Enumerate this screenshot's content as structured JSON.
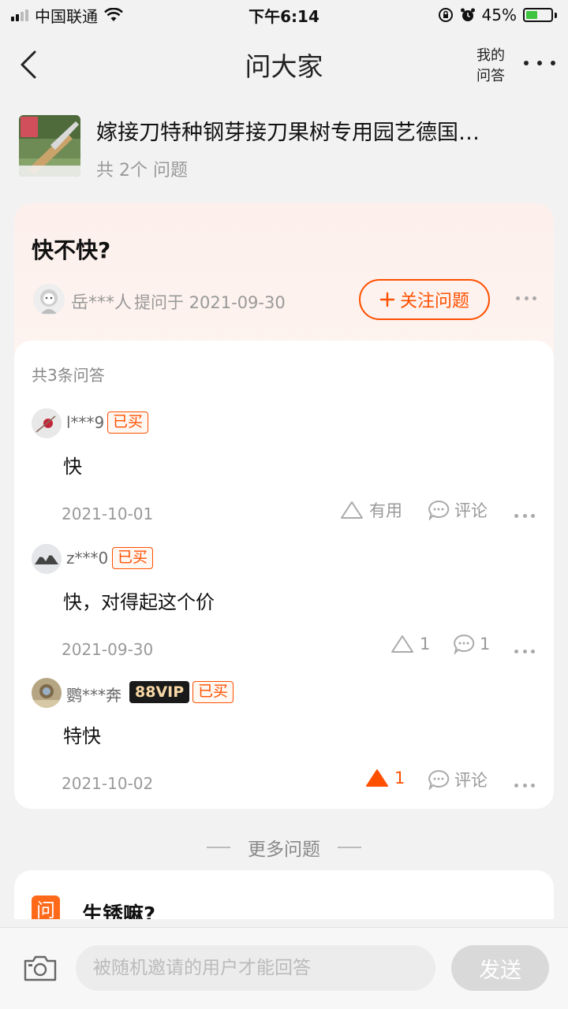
{
  "status_bar": {
    "carrier": "中国联通",
    "time": "下午6:14",
    "battery": "45%",
    "battery_level": 0.45
  },
  "nav": {
    "title": "问大家",
    "my_qa": "我的问答"
  },
  "product": {
    "name": "嫁接刀特种钢芽接刀果树专用园艺德国…",
    "question_count": "共 2个 问题"
  },
  "question": {
    "title": "快不快?",
    "asker": "岳***人",
    "asked_meta": "提问于 2021-09-30",
    "follow_label": "关注问题"
  },
  "answers_header": "共3条问答",
  "answers": [
    {
      "user": "l***9",
      "bought_tag": "已买",
      "vip_tag": "",
      "text": "快",
      "date": "2021-10-01",
      "useful": "有用",
      "useful_active": false,
      "comment": "评论"
    },
    {
      "user": "z***0",
      "bought_tag": "已买",
      "vip_tag": "",
      "text": "快，对得起这个价",
      "date": "2021-09-30",
      "useful": "1",
      "useful_active": false,
      "comment": "1"
    },
    {
      "user": "鹦***奔",
      "bought_tag": "已买",
      "vip_tag": "88VIP",
      "text": "特快",
      "date": "2021-10-02",
      "useful": "1",
      "useful_active": true,
      "comment": "评论"
    }
  ],
  "more_questions_label": "更多问题",
  "next_question": {
    "icon_text": "问",
    "title": "生锈嘛?"
  },
  "bottom_bar": {
    "input_placeholder": "被随机邀请的用户才能回答",
    "send_label": "发送"
  },
  "colors": {
    "accent": "#ff5000",
    "background": "#f2f2f2",
    "question_card": "#fdf0ec"
  }
}
